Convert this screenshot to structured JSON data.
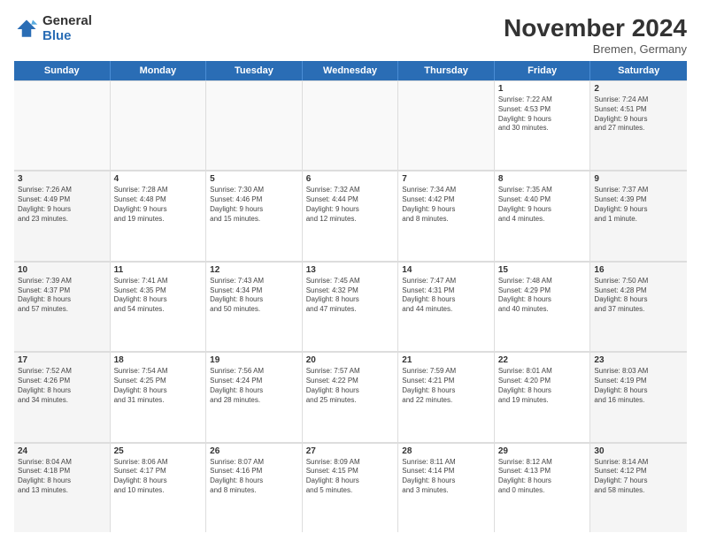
{
  "logo": {
    "general": "General",
    "blue": "Blue"
  },
  "title": "November 2024",
  "location": "Bremen, Germany",
  "header_days": [
    "Sunday",
    "Monday",
    "Tuesday",
    "Wednesday",
    "Thursday",
    "Friday",
    "Saturday"
  ],
  "weeks": [
    [
      {
        "day": "",
        "info": ""
      },
      {
        "day": "",
        "info": ""
      },
      {
        "day": "",
        "info": ""
      },
      {
        "day": "",
        "info": ""
      },
      {
        "day": "",
        "info": ""
      },
      {
        "day": "1",
        "info": "Sunrise: 7:22 AM\nSunset: 4:53 PM\nDaylight: 9 hours\nand 30 minutes."
      },
      {
        "day": "2",
        "info": "Sunrise: 7:24 AM\nSunset: 4:51 PM\nDaylight: 9 hours\nand 27 minutes."
      }
    ],
    [
      {
        "day": "3",
        "info": "Sunrise: 7:26 AM\nSunset: 4:49 PM\nDaylight: 9 hours\nand 23 minutes."
      },
      {
        "day": "4",
        "info": "Sunrise: 7:28 AM\nSunset: 4:48 PM\nDaylight: 9 hours\nand 19 minutes."
      },
      {
        "day": "5",
        "info": "Sunrise: 7:30 AM\nSunset: 4:46 PM\nDaylight: 9 hours\nand 15 minutes."
      },
      {
        "day": "6",
        "info": "Sunrise: 7:32 AM\nSunset: 4:44 PM\nDaylight: 9 hours\nand 12 minutes."
      },
      {
        "day": "7",
        "info": "Sunrise: 7:34 AM\nSunset: 4:42 PM\nDaylight: 9 hours\nand 8 minutes."
      },
      {
        "day": "8",
        "info": "Sunrise: 7:35 AM\nSunset: 4:40 PM\nDaylight: 9 hours\nand 4 minutes."
      },
      {
        "day": "9",
        "info": "Sunrise: 7:37 AM\nSunset: 4:39 PM\nDaylight: 9 hours\nand 1 minute."
      }
    ],
    [
      {
        "day": "10",
        "info": "Sunrise: 7:39 AM\nSunset: 4:37 PM\nDaylight: 8 hours\nand 57 minutes."
      },
      {
        "day": "11",
        "info": "Sunrise: 7:41 AM\nSunset: 4:35 PM\nDaylight: 8 hours\nand 54 minutes."
      },
      {
        "day": "12",
        "info": "Sunrise: 7:43 AM\nSunset: 4:34 PM\nDaylight: 8 hours\nand 50 minutes."
      },
      {
        "day": "13",
        "info": "Sunrise: 7:45 AM\nSunset: 4:32 PM\nDaylight: 8 hours\nand 47 minutes."
      },
      {
        "day": "14",
        "info": "Sunrise: 7:47 AM\nSunset: 4:31 PM\nDaylight: 8 hours\nand 44 minutes."
      },
      {
        "day": "15",
        "info": "Sunrise: 7:48 AM\nSunset: 4:29 PM\nDaylight: 8 hours\nand 40 minutes."
      },
      {
        "day": "16",
        "info": "Sunrise: 7:50 AM\nSunset: 4:28 PM\nDaylight: 8 hours\nand 37 minutes."
      }
    ],
    [
      {
        "day": "17",
        "info": "Sunrise: 7:52 AM\nSunset: 4:26 PM\nDaylight: 8 hours\nand 34 minutes."
      },
      {
        "day": "18",
        "info": "Sunrise: 7:54 AM\nSunset: 4:25 PM\nDaylight: 8 hours\nand 31 minutes."
      },
      {
        "day": "19",
        "info": "Sunrise: 7:56 AM\nSunset: 4:24 PM\nDaylight: 8 hours\nand 28 minutes."
      },
      {
        "day": "20",
        "info": "Sunrise: 7:57 AM\nSunset: 4:22 PM\nDaylight: 8 hours\nand 25 minutes."
      },
      {
        "day": "21",
        "info": "Sunrise: 7:59 AM\nSunset: 4:21 PM\nDaylight: 8 hours\nand 22 minutes."
      },
      {
        "day": "22",
        "info": "Sunrise: 8:01 AM\nSunset: 4:20 PM\nDaylight: 8 hours\nand 19 minutes."
      },
      {
        "day": "23",
        "info": "Sunrise: 8:03 AM\nSunset: 4:19 PM\nDaylight: 8 hours\nand 16 minutes."
      }
    ],
    [
      {
        "day": "24",
        "info": "Sunrise: 8:04 AM\nSunset: 4:18 PM\nDaylight: 8 hours\nand 13 minutes."
      },
      {
        "day": "25",
        "info": "Sunrise: 8:06 AM\nSunset: 4:17 PM\nDaylight: 8 hours\nand 10 minutes."
      },
      {
        "day": "26",
        "info": "Sunrise: 8:07 AM\nSunset: 4:16 PM\nDaylight: 8 hours\nand 8 minutes."
      },
      {
        "day": "27",
        "info": "Sunrise: 8:09 AM\nSunset: 4:15 PM\nDaylight: 8 hours\nand 5 minutes."
      },
      {
        "day": "28",
        "info": "Sunrise: 8:11 AM\nSunset: 4:14 PM\nDaylight: 8 hours\nand 3 minutes."
      },
      {
        "day": "29",
        "info": "Sunrise: 8:12 AM\nSunset: 4:13 PM\nDaylight: 8 hours\nand 0 minutes."
      },
      {
        "day": "30",
        "info": "Sunrise: 8:14 AM\nSunset: 4:12 PM\nDaylight: 7 hours\nand 58 minutes."
      }
    ]
  ]
}
